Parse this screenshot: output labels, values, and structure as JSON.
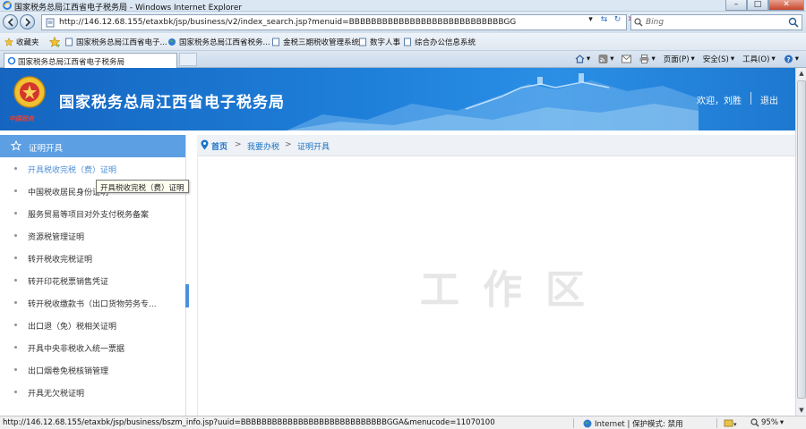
{
  "window": {
    "title": "国家税务总局江西省电子税务局 - Windows Internet Explorer",
    "controls": {
      "minimize": "–",
      "maximize": "□",
      "close": "✕"
    }
  },
  "address_bar": {
    "url": "http://146.12.68.155/etaxbk/jsp/business/v2/index_search.jsp?menuid=BBBBBBBBBBBBBBBBBBBBBBBBBBBBGG",
    "search_placeholder": "Bing"
  },
  "favorites_bar": {
    "favorites_label": "收藏夹",
    "items": [
      {
        "label": "国家税务总局江西省电子...",
        "icon": "page-icon"
      },
      {
        "label": "国家税务总局江西省税务...",
        "icon": "globe-icon"
      },
      {
        "label": "金税三期税收管理系统",
        "icon": "page-icon"
      },
      {
        "label": "数字人事",
        "icon": "page-icon"
      },
      {
        "label": "综合办公信息系统",
        "icon": "page-icon"
      }
    ]
  },
  "tabs": [
    {
      "label": "国家税务总局江西省电子税务局"
    }
  ],
  "command_bar": {
    "page": "页面(P)",
    "safety": "安全(S)",
    "tools": "工具(O)"
  },
  "header": {
    "site_title": "国家税务总局江西省电子税务局",
    "emblem_caption": "中国税务",
    "welcome": "欢迎，刘胜",
    "logout": "退出"
  },
  "sidebar": {
    "heading": "证明开具",
    "items": [
      {
        "label": "开具税收完税（费）证明",
        "active": true
      },
      {
        "label": "中国税收居民身份证明"
      },
      {
        "label": "服务贸易等项目对外支付税务备案"
      },
      {
        "label": "资源税管理证明"
      },
      {
        "label": "转开税收完税证明"
      },
      {
        "label": "转开印花税票销售凭证"
      },
      {
        "label": "转开税收缴款书（出口货物劳务专..."
      },
      {
        "label": "出口退（免）税相关证明"
      },
      {
        "label": "开具中央非税收入统一票据"
      },
      {
        "label": "出口烟卷免税核销管理"
      },
      {
        "label": "开具无欠税证明"
      }
    ],
    "tooltip": "开具税收完税（费）证明"
  },
  "breadcrumb": {
    "home": "首页",
    "sep": ">",
    "level1": "我要办税",
    "level2": "证明开具"
  },
  "workarea": {
    "watermark": "工作区"
  },
  "status_bar": {
    "url": "http://146.12.68.155/etaxbk/jsp/business/bszm_info.jsp?uuid=BBBBBBBBBBBBBBBBBBBBBBBBBBBBGGA&menucode=11070100",
    "zone": "Internet | 保护模式: 禁用",
    "zoom": "95%"
  },
  "colors": {
    "banner": "#1e7fd9",
    "sidebar_header": "#5d9fe3",
    "link": "#1a73c7"
  }
}
